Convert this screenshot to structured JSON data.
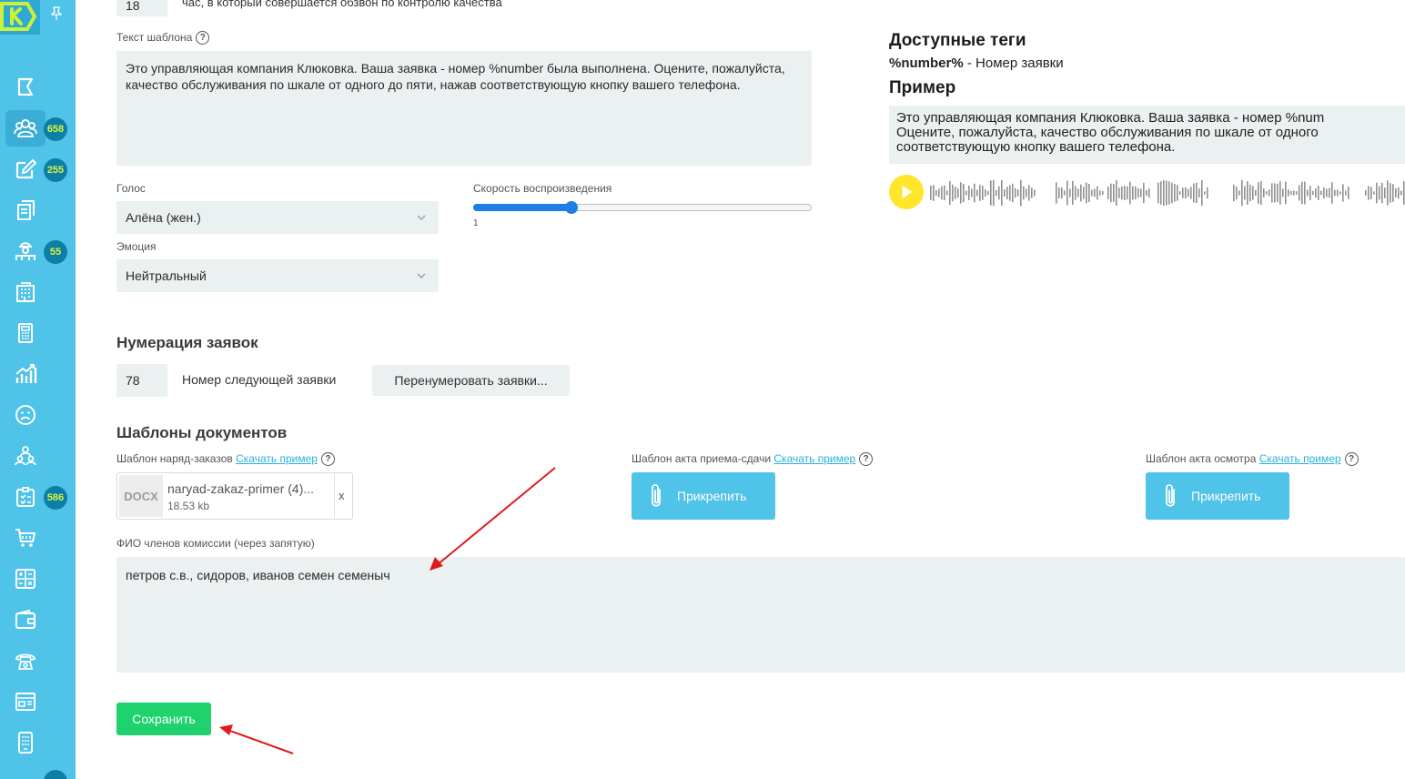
{
  "sidebar": {
    "items": [
      {
        "icon": "flag-icon"
      },
      {
        "icon": "users-icon",
        "badge": "658",
        "active": true
      },
      {
        "icon": "edit-icon",
        "badge": "255"
      },
      {
        "icon": "documents-icon"
      },
      {
        "icon": "worker-icon",
        "badge": "55"
      },
      {
        "icon": "building-icon"
      },
      {
        "icon": "calculator-icon"
      },
      {
        "icon": "chart-icon"
      },
      {
        "icon": "sad-face-icon"
      },
      {
        "icon": "team-icon"
      },
      {
        "icon": "checklist-icon",
        "badge": "586"
      },
      {
        "icon": "cart-icon"
      },
      {
        "icon": "calc-grid-icon"
      },
      {
        "icon": "wallet-icon"
      },
      {
        "icon": "phone-icon"
      },
      {
        "icon": "newspaper-icon"
      },
      {
        "icon": "mobile-icon"
      }
    ]
  },
  "top": {
    "hour_value": "18",
    "hour_caption": "час, в который совершается обзвон по контролю качества"
  },
  "template": {
    "label": "Текст шаблона",
    "text": "Это управляющая компания Клюковка. Ваша заявка - номер %number была выполнена. Оцените, пожалуйста, качество обслуживания по шкале от одного до пяти, нажав соответствующую кнопку вашего телефона."
  },
  "voice": {
    "label": "Голос",
    "value": "Алёна (жен.)"
  },
  "emotion": {
    "label": "Эмоция",
    "value": "Нейтральный"
  },
  "speed": {
    "label": "Скорость воспроизведения",
    "value": "1",
    "fraction": 0.29
  },
  "tags": {
    "title": "Доступные теги",
    "tag": "%number%",
    "desc": " - Номер заявки"
  },
  "example": {
    "title": "Пример",
    "lines": [
      "Это управляющая компания Клюковка. Ваша заявка - номер %num",
      "Оцените, пожалуйста, качество обслуживания по шкале от одного",
      "соответствующую кнопку вашего телефона."
    ]
  },
  "numbering": {
    "title": "Нумерация заявок",
    "next_value": "78",
    "next_label": "Номер следующей заявки",
    "renumber_button": "Перенумеровать заявки..."
  },
  "documents": {
    "title": "Шаблоны документов",
    "work_order": {
      "label": "Шаблон наряд-заказов",
      "link": "Скачать пример",
      "file_type": "DOCX",
      "file_name": "naryad-zakaz-primer (4)...",
      "file_size": "18.53 kb",
      "remove": "x"
    },
    "acceptance": {
      "label": "Шаблон акта приема-сдачи",
      "link": "Скачать пример",
      "button": "Прикрепить"
    },
    "inspection": {
      "label": "Шаблон акта осмотра",
      "link": "Скачать пример",
      "button": "Прикрепить"
    }
  },
  "commission": {
    "label": "ФИО членов комиссии (через запятую)",
    "value": "петров с.в., сидоров, иванов семен семеныч"
  },
  "save_button": "Сохранить",
  "colors": {
    "sidebar": "#4fc3e8",
    "accent": "#29b1d8",
    "save": "#1fd26e",
    "badge": "#0d7fa5",
    "badge_text": "#d8f543",
    "play": "#ffe629",
    "arrow": "#e01b1b"
  }
}
